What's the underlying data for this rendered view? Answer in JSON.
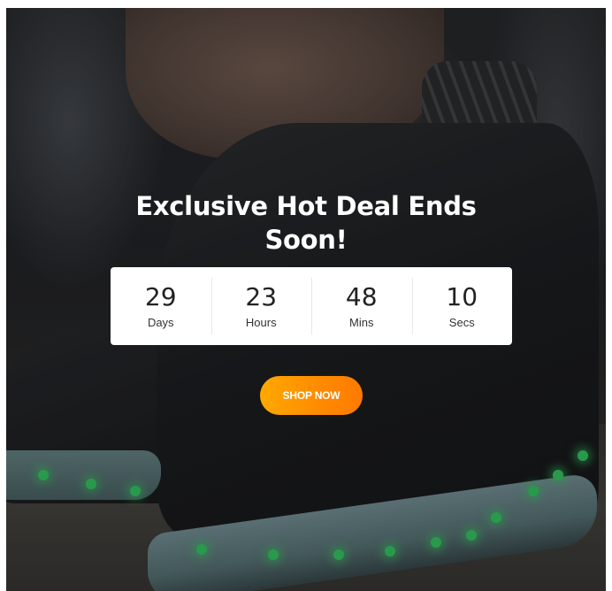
{
  "banner": {
    "title_line1": "Exclusive Hot Deal Ends",
    "title_line2": "Soon!",
    "countdown": [
      {
        "value": "29",
        "label": "Days"
      },
      {
        "value": "23",
        "label": "Hours"
      },
      {
        "value": "48",
        "label": "Mins"
      },
      {
        "value": "10",
        "label": "Secs"
      }
    ],
    "button_label": "SHOP NOW",
    "colors": {
      "button_start": "#ffa800",
      "button_end": "#ff7a00",
      "panel": "#ffffff",
      "title": "#ffffff"
    },
    "background_image": "sneaker-photo"
  }
}
